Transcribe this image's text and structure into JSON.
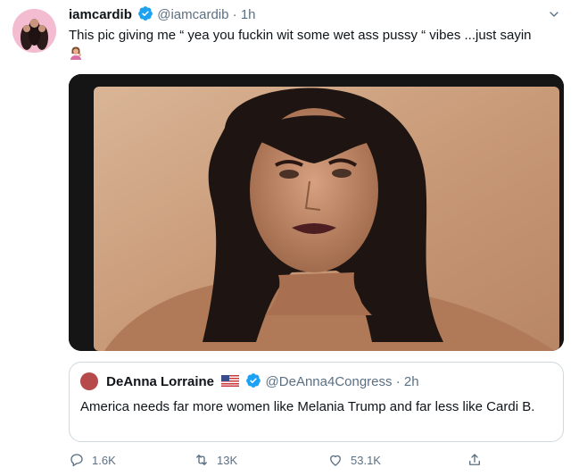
{
  "tweet": {
    "display_name": "iamcardib",
    "handle": "@iamcardib",
    "separator": "·",
    "time": "1h",
    "text": "This pic giving me “ yea you fuckin wit some wet ass pussy “ vibes ...just sayin"
  },
  "quote": {
    "display_name": "DeAnna Lorraine",
    "handle": "@DeAnna4Congress",
    "separator": "·",
    "time": "2h",
    "text": "America needs far more women like Melania Trump and far less like Cardi B."
  },
  "actions": {
    "replies": "1.6K",
    "retweets": "13K",
    "likes": "53.1K"
  },
  "colors": {
    "verified": "#1da1f2",
    "secondary_text": "#5b7083",
    "border": "#cfd9de"
  },
  "icons": [
    "verified-badge-icon",
    "chevron-down-icon",
    "woman-tipping-hand-emoji",
    "us-flag-icon",
    "reply-icon",
    "retweet-icon",
    "like-icon",
    "share-icon"
  ]
}
